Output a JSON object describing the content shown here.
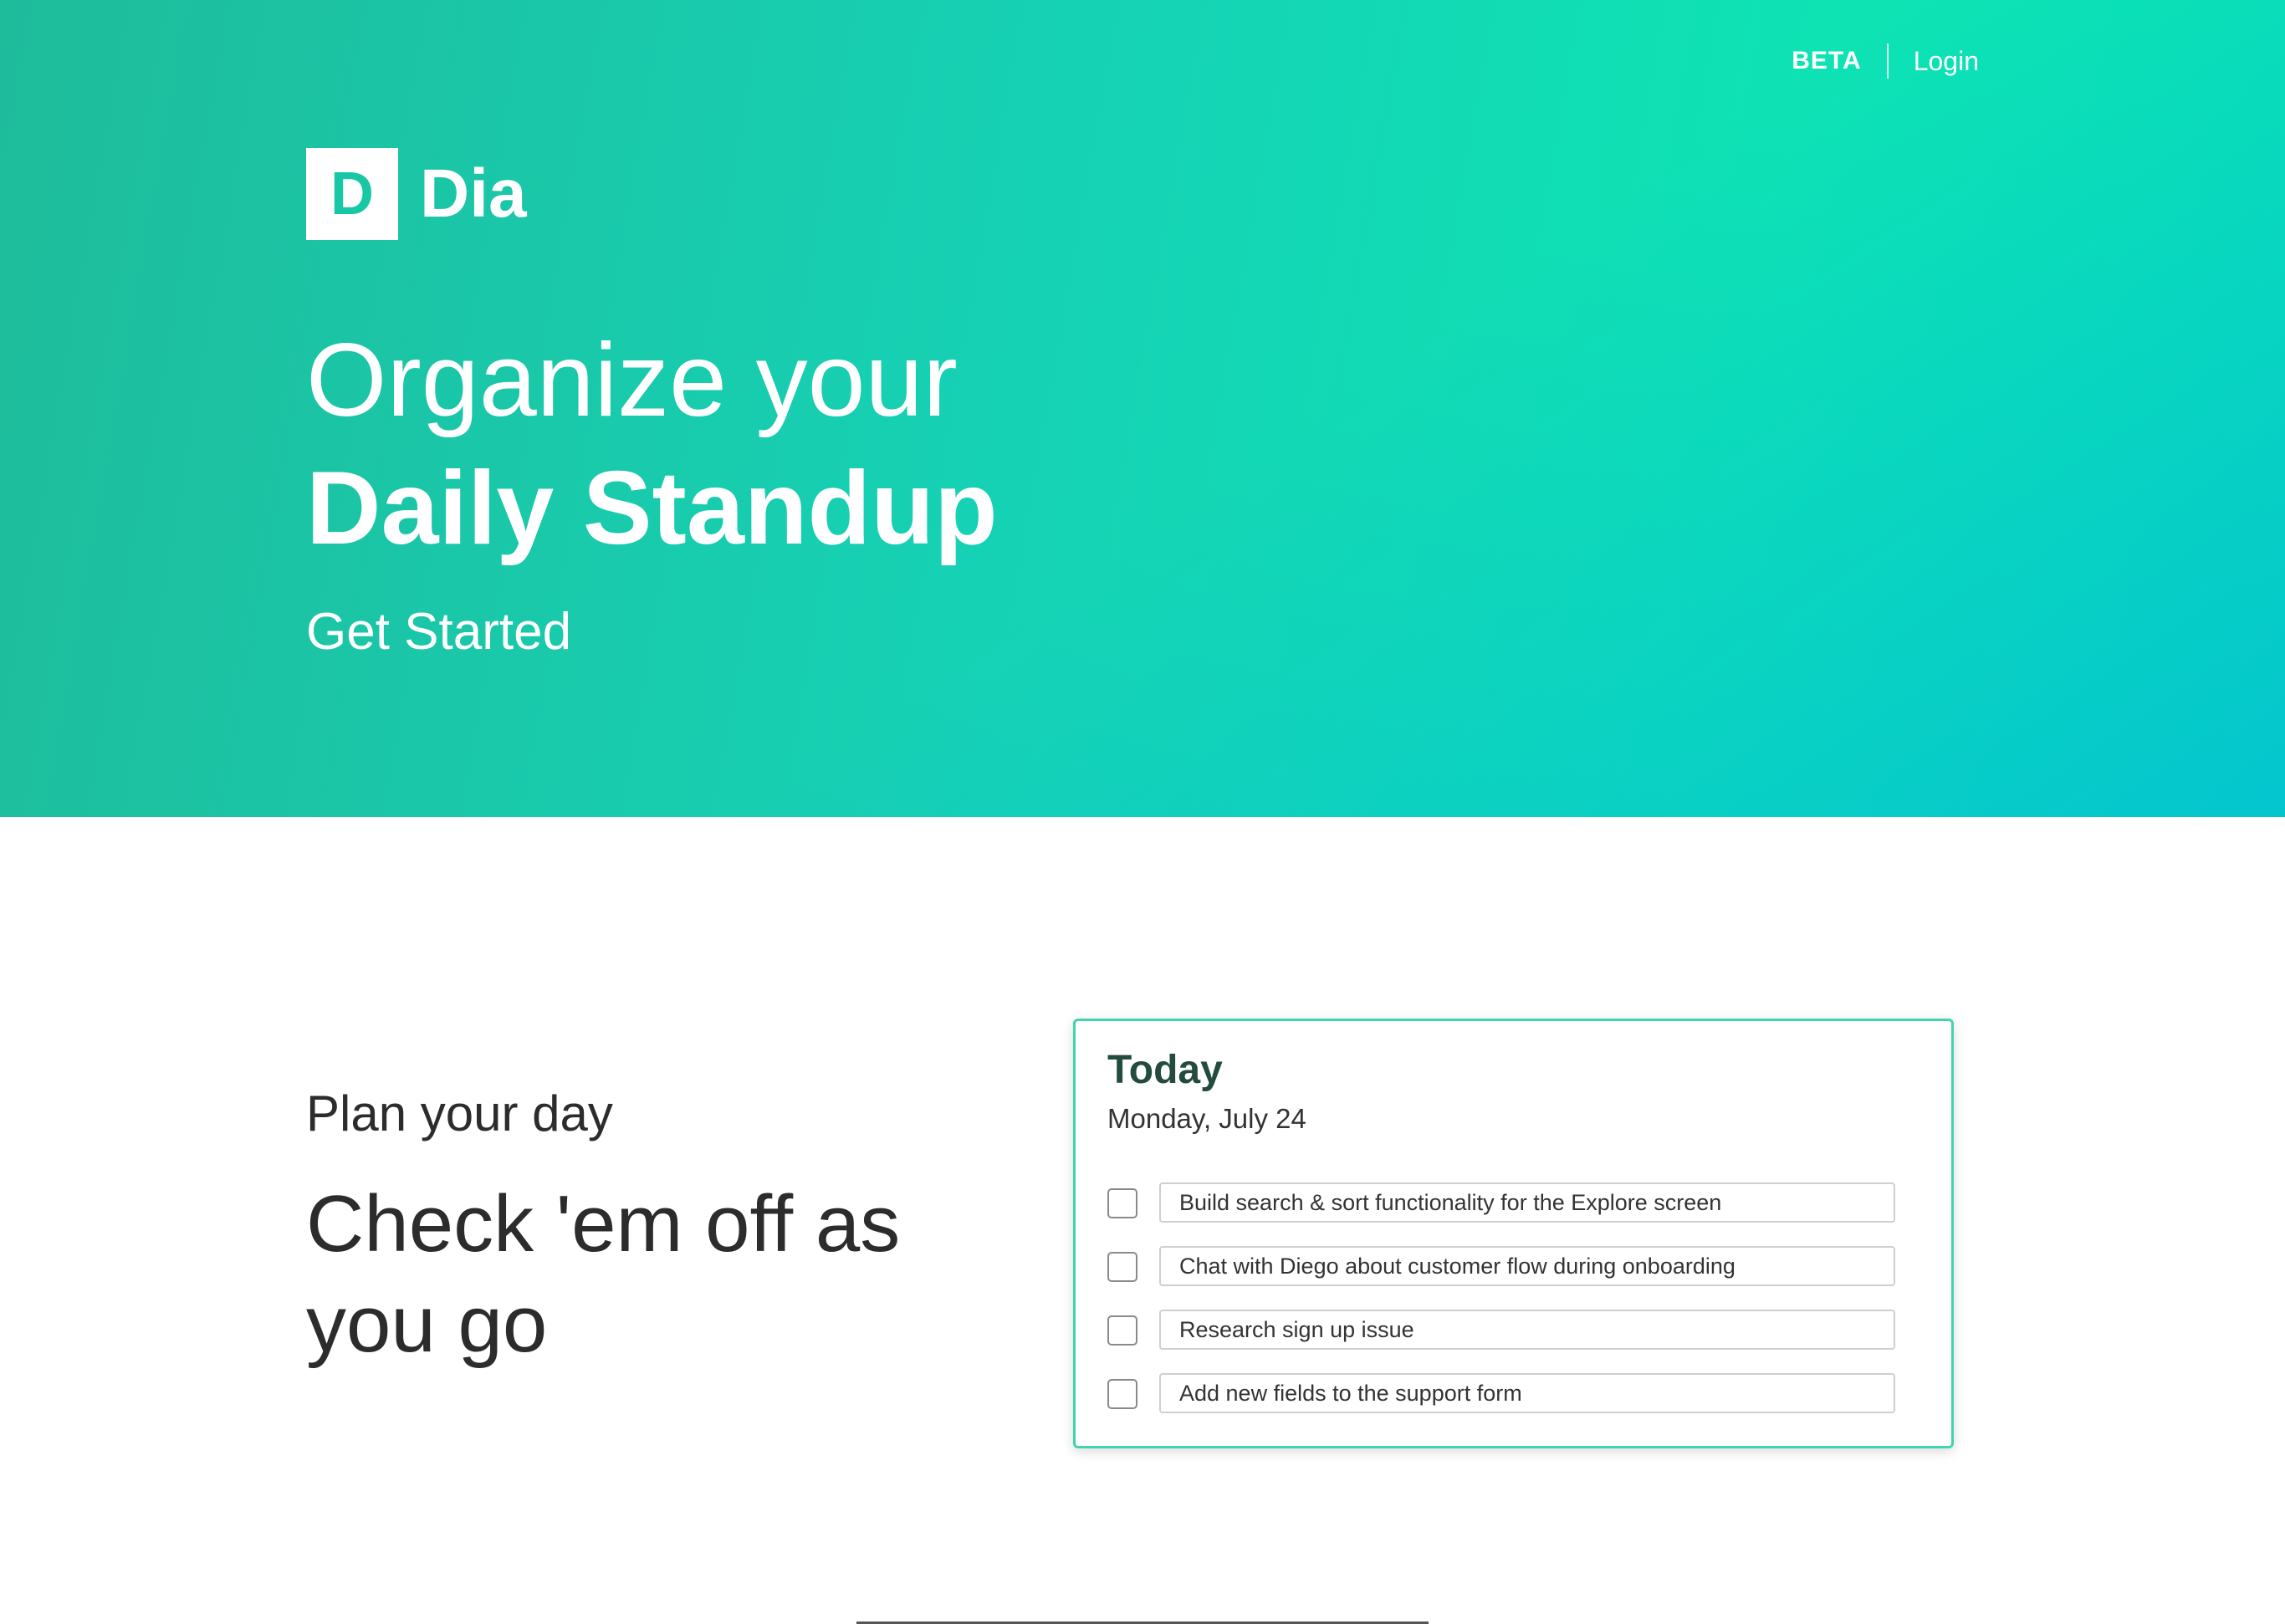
{
  "nav": {
    "beta_label": "BETA",
    "login_label": "Login"
  },
  "logo": {
    "mark": "D",
    "name": "Dia"
  },
  "hero": {
    "headline_light": "Organize your",
    "headline_bold": "Daily Standup",
    "cta_label": "Get Started"
  },
  "feature": {
    "subtitle": "Plan your day",
    "title": "Check 'em off as you go"
  },
  "card": {
    "title": "Today",
    "date": "Monday, July 24",
    "tasks": [
      {
        "text": "Build search & sort functionality for the Explore screen",
        "checked": false
      },
      {
        "text": "Chat with Diego about customer flow during onboarding",
        "checked": false
      },
      {
        "text": "Research sign up issue",
        "checked": false
      },
      {
        "text": "Add new fields to the support form",
        "checked": false
      }
    ]
  },
  "colors": {
    "brand_green": "#17c7a6",
    "card_border": "#3fd6ae",
    "card_title": "#244c3e"
  }
}
